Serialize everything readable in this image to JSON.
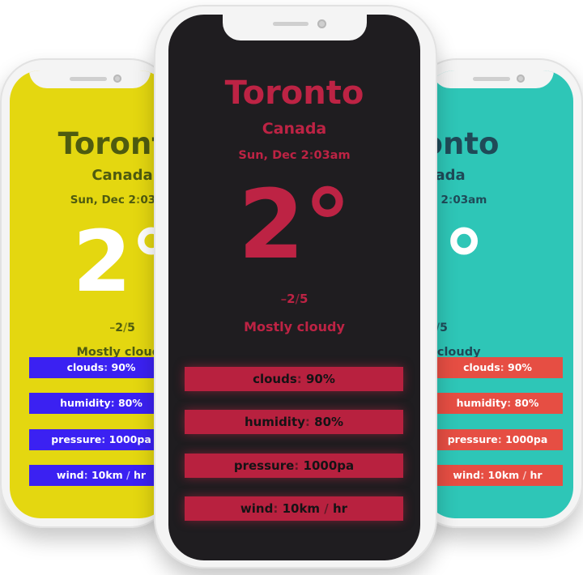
{
  "phones": {
    "left": {
      "city": "Toronto",
      "country": "Canada",
      "date": "Sun, Dec 2",
      "time": "03am",
      "temp": "2°",
      "low": "2",
      "high": "5",
      "condition": "Mostly cloudy",
      "stats": [
        {
          "label": "clouds",
          "value": "90%"
        },
        {
          "label": "humidity",
          "value": "80%"
        },
        {
          "label": "pressure",
          "value": "1000pa"
        },
        {
          "label": "wind",
          "value": "10km",
          "unit": "hr"
        }
      ],
      "colors": {
        "background": "#e4d710",
        "text": "#4e5b10",
        "bar": "#3b21f2"
      }
    },
    "center": {
      "city": "Toronto",
      "country": "Canada",
      "date": "Sun, Dec 2",
      "time": "03am",
      "temp": "2°",
      "low": "2",
      "high": "5",
      "condition": "Mostly cloudy",
      "stats": [
        {
          "label": "clouds",
          "value": "90%"
        },
        {
          "label": "humidity",
          "value": "80%"
        },
        {
          "label": "pressure",
          "value": "1000pa"
        },
        {
          "label": "wind",
          "value": "10km",
          "unit": "hr"
        }
      ],
      "colors": {
        "background": "#1f1d20",
        "text": "#bd2344",
        "bar": "#b8213f"
      }
    },
    "right": {
      "city": "Toronto",
      "country": "Canada",
      "date": "Sun, Dec 2",
      "time": "03am",
      "temp": "2°",
      "low": "2",
      "high": "5",
      "condition": "Mostly cloudy",
      "stats": [
        {
          "label": "clouds",
          "value": "90%"
        },
        {
          "label": "humidity",
          "value": "80%"
        },
        {
          "label": "pressure",
          "value": "1000pa"
        },
        {
          "label": "wind",
          "value": "10km",
          "unit": "hr"
        }
      ],
      "colors": {
        "background": "#2ec6b7",
        "text": "#1f4a58",
        "bar": "#e64e43"
      }
    }
  }
}
